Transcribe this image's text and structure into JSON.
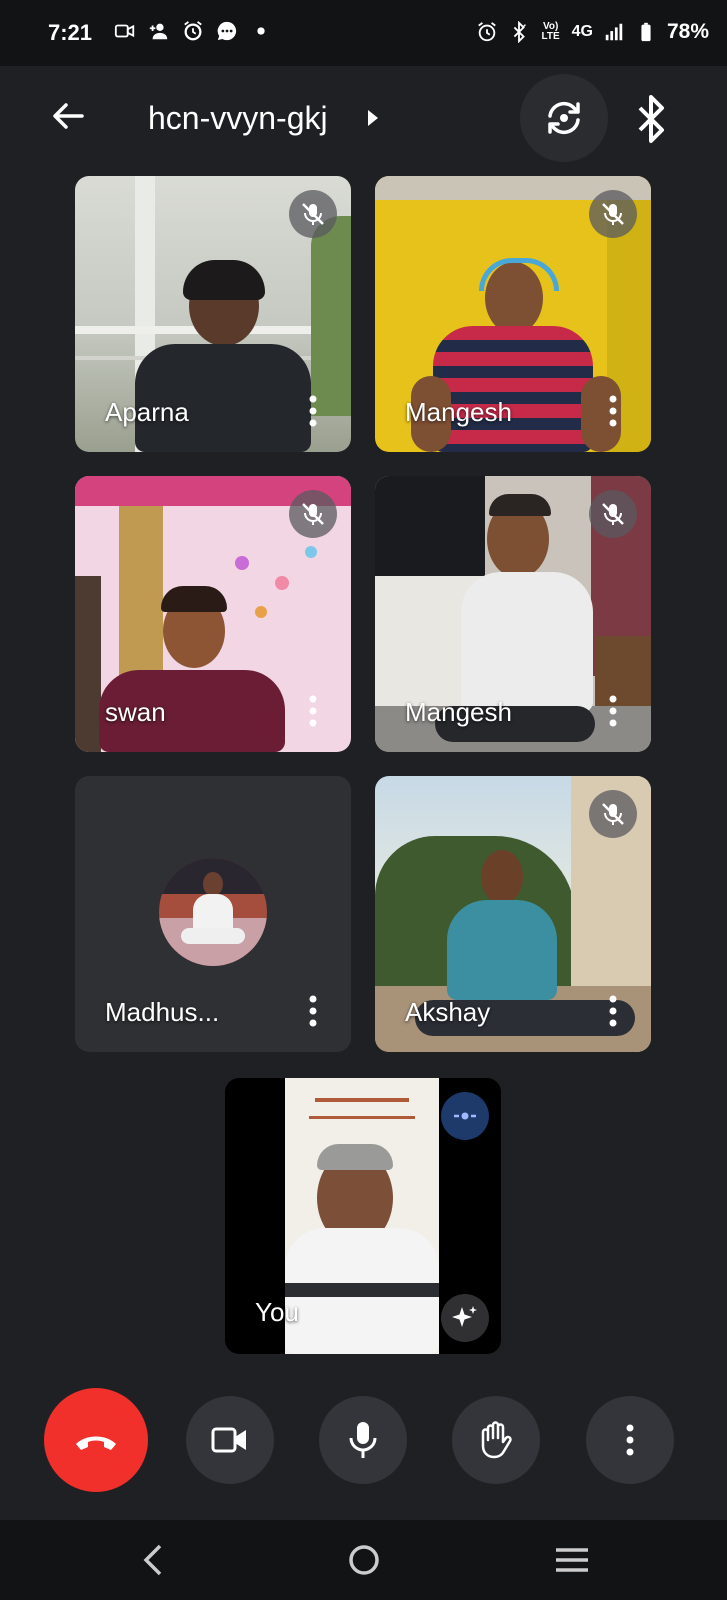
{
  "status_bar": {
    "time": "7:21",
    "battery": "78%",
    "network": "4G",
    "volte": "Vo) LTE",
    "icons": [
      "video-notification-icon",
      "add-person-icon",
      "alarm-icon",
      "chat-bubble-icon",
      "dot-icon",
      "alarm-clock-icon",
      "bluetooth-icon",
      "signal-icon",
      "battery-icon"
    ]
  },
  "header": {
    "meeting_code": "hcn-vvyn-gkj",
    "icons": [
      "back-arrow-icon",
      "chevron-right-icon",
      "switch-camera-icon",
      "bluetooth-audio-icon"
    ]
  },
  "participants": [
    {
      "name": "Aparna",
      "muted": true
    },
    {
      "name": "Mangesh",
      "muted": true
    },
    {
      "name": "swan",
      "muted": true
    },
    {
      "name": "Mangesh",
      "muted": true
    },
    {
      "name": "Madhus...",
      "muted": false,
      "video_off": true
    },
    {
      "name": "Akshay",
      "muted": true
    }
  ],
  "self": {
    "name": "You"
  },
  "controls": [
    "end-call",
    "camera",
    "microphone",
    "raise-hand",
    "more-options"
  ],
  "colors": {
    "background": "#1f2023",
    "end_call": "#f2302b",
    "control_button": "#34353a",
    "minimize_button": "#1e3a6a"
  }
}
